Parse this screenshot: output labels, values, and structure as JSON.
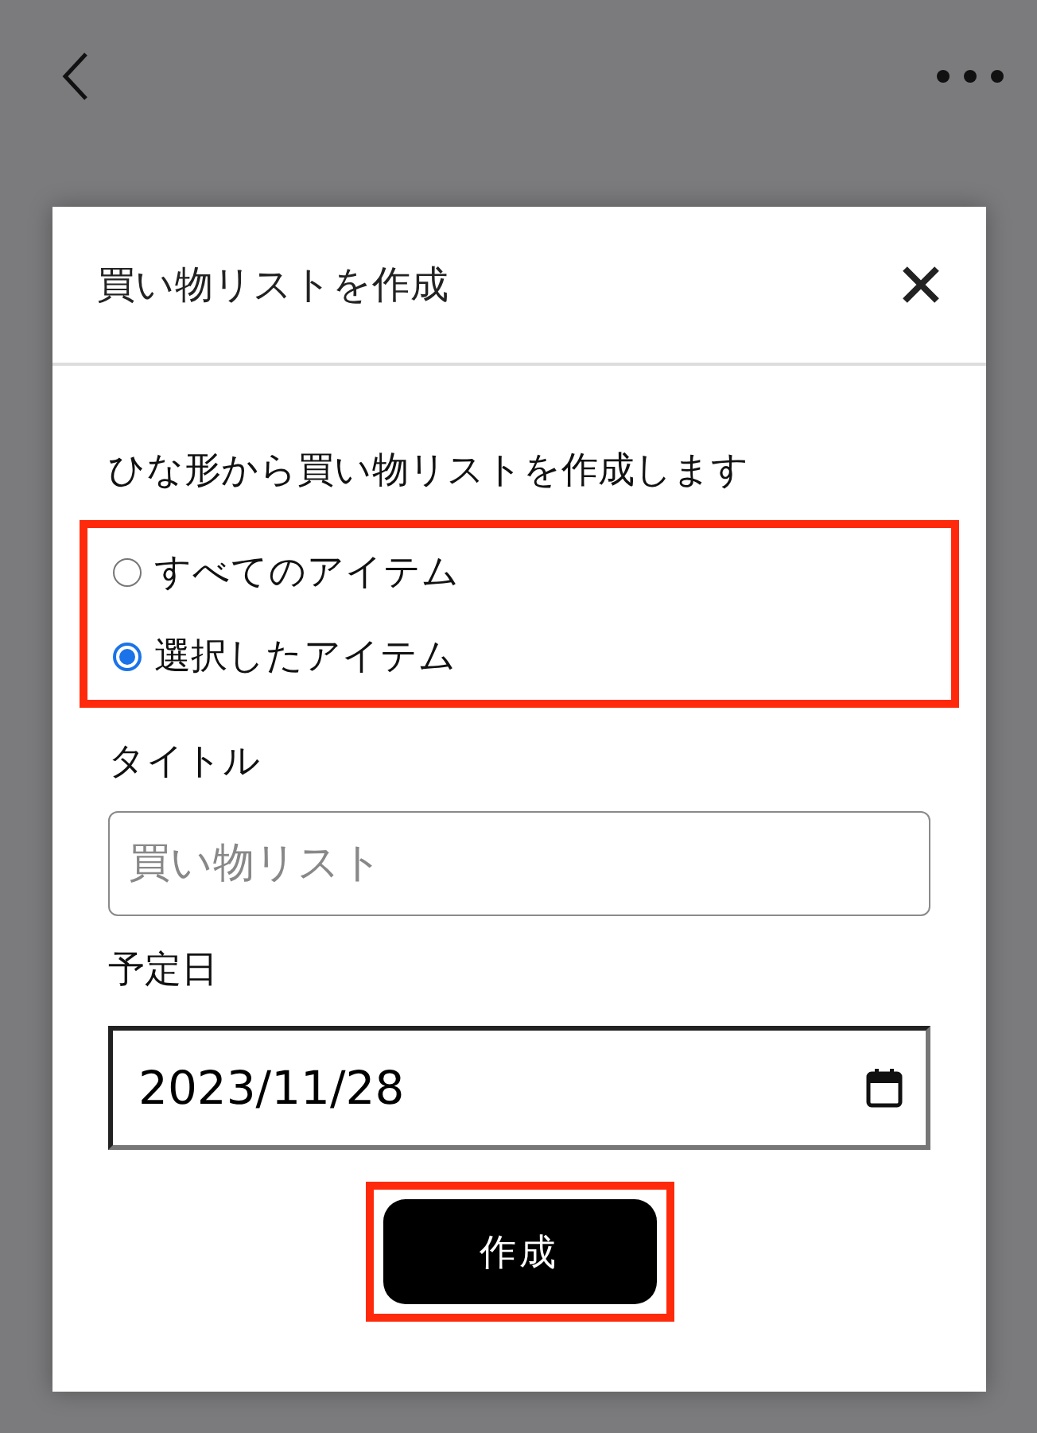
{
  "dialog": {
    "title": "買い物リストを作成",
    "prompt": "ひな形から買い物リストを作成します",
    "options_highlighted": true,
    "options": [
      {
        "label": "すべてのアイテム",
        "selected": false
      },
      {
        "label": "選択したアイテム",
        "selected": true
      }
    ],
    "title_field": {
      "label": "タイトル",
      "placeholder": "買い物リスト"
    },
    "date_field": {
      "label": "予定日",
      "value": "2023/11/28"
    },
    "submit": {
      "label": "作成",
      "highlighted": true
    }
  }
}
